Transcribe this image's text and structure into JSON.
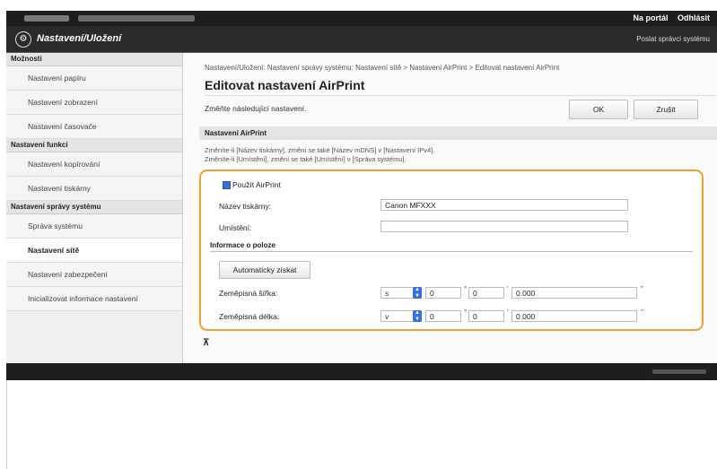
{
  "topbar": {
    "portal_label": "Na portál",
    "logout_label": "Odhlásit"
  },
  "titlebar": {
    "title": "Nastavení/Uložení",
    "admin_link": "Poslat správci systému"
  },
  "sidebar": {
    "groups": [
      {
        "heading": "Možnosti",
        "items": [
          "Nastavení papíru",
          "Nastavení zobrazení",
          "Nastavení časovače"
        ]
      },
      {
        "heading": "Nastavení funkcí",
        "items": [
          "Nastavení kopírování",
          "Nastavení tiskárny"
        ]
      },
      {
        "heading": "Nastavení správy systému",
        "items": [
          "Správa systému",
          "Nastavení sítě",
          "Nastavení zabezpečení",
          "Inicializovat informace nastavení"
        ]
      }
    ],
    "active": "Nastavení sítě"
  },
  "main": {
    "breadcrumb": "Nastavení/Uložení: Nastavení správy systému: Nastavení sítě > Nastavení AirPrint > Editovat nastavení AirPrint",
    "title": "Editovat nastavení AirPrint",
    "hint": "Změňte následující nastavení.",
    "ok_label": "OK",
    "cancel_label": "Zrušit",
    "section_title": "Nastavení AirPrint",
    "note_line1": "Změníte-li [Název tiskárny], změní se také [Název mDNS] v [Nastavení IPv4].",
    "note_line2": "Změníte-li [Umístění], změní se také [Umístění] v [Správa systému].",
    "use_airprint_label": "Použít AirPrint",
    "use_airprint_checked": true,
    "printer_name_label": "Název tiskárny:",
    "printer_name_value": "Canon MFXXX",
    "location_label": "Umístění:",
    "location_value": "",
    "position_heading": "Informace o poloze",
    "auto_button": "Automaticky získat",
    "latitude_label": "Zeměpisná šířka:",
    "latitude": {
      "dir": "s",
      "deg": "0",
      "min": "0",
      "sec": "0.000"
    },
    "longitude_label": "Zeměpisná délka:",
    "longitude": {
      "dir": "v",
      "deg": "0",
      "min": "0",
      "sec": "0.000"
    },
    "units": {
      "deg": "°",
      "min": "'",
      "sec": "\""
    },
    "top_icon": "⊼"
  }
}
